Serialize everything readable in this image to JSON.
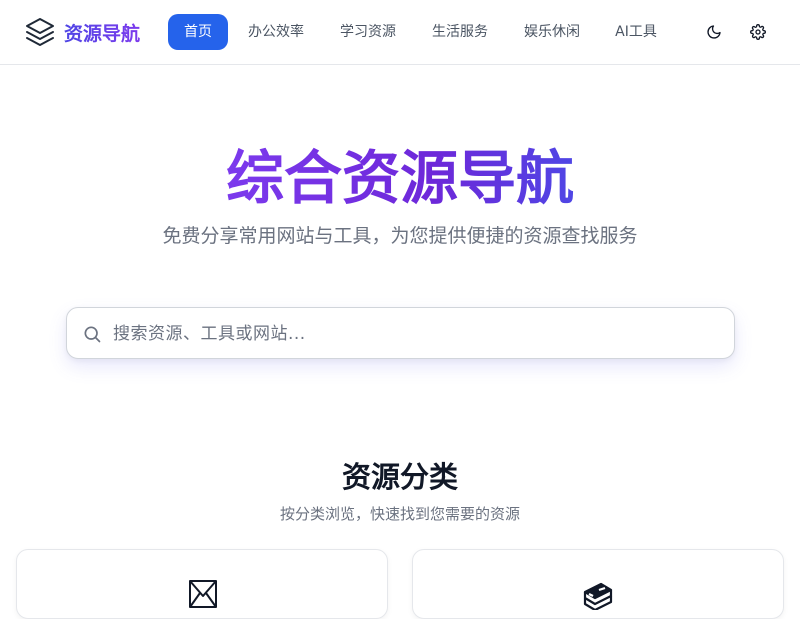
{
  "header": {
    "logo_text": "资源导航",
    "nav": [
      {
        "label": "首页",
        "active": true
      },
      {
        "label": "办公效率"
      },
      {
        "label": "学习资源"
      },
      {
        "label": "生活服务"
      },
      {
        "label": "娱乐休闲"
      },
      {
        "label": "AI工具"
      }
    ],
    "icons": [
      "theme-toggle-moon-icon",
      "settings-gear-icon"
    ]
  },
  "hero": {
    "title": "综合资源导航",
    "subtitle": "免费分享常用网站与工具，为您提供便捷的资源查找服务"
  },
  "search": {
    "placeholder": "搜索资源、工具或网站..."
  },
  "categories": {
    "title": "资源分类",
    "subtitle": "按分类浏览，快速找到您需要的资源",
    "cards": [
      {
        "icon": "envelope-icon"
      },
      {
        "icon": "books-stack-icon"
      }
    ]
  },
  "colors": {
    "accent": "#2563eb",
    "brand_gradient_start": "#7c3aed",
    "brand_gradient_end": "#4f46e5"
  }
}
